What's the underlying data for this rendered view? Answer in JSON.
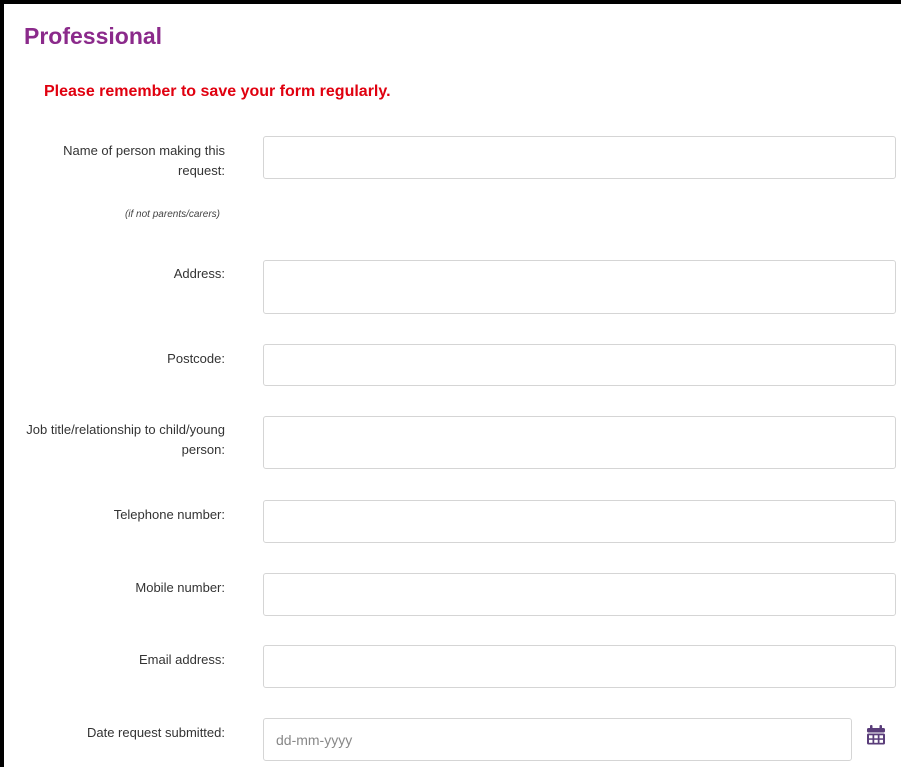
{
  "section": {
    "title": "Professional",
    "reminder": "Please remember to save your form regularly."
  },
  "fields": {
    "name": {
      "label": "Name of person making this request:",
      "hint": "(if not parents/carers)",
      "value": ""
    },
    "address": {
      "label": "Address:",
      "value": ""
    },
    "postcode": {
      "label": "Postcode:",
      "value": ""
    },
    "job_title": {
      "label": "Job title/relationship to child/young person:",
      "value": ""
    },
    "telephone": {
      "label": "Telephone number:",
      "value": ""
    },
    "mobile": {
      "label": "Mobile number:",
      "value": ""
    },
    "email": {
      "label": "Email address:",
      "value": ""
    },
    "date_submitted": {
      "label": "Date request submitted:",
      "placeholder": "dd-mm-yyyy",
      "value": ""
    }
  },
  "icons": {
    "calendar": "calendar-icon"
  },
  "colors": {
    "title": "#8b2a8b",
    "reminder": "#e0000f",
    "calendar_icon": "#5a3d7a"
  }
}
